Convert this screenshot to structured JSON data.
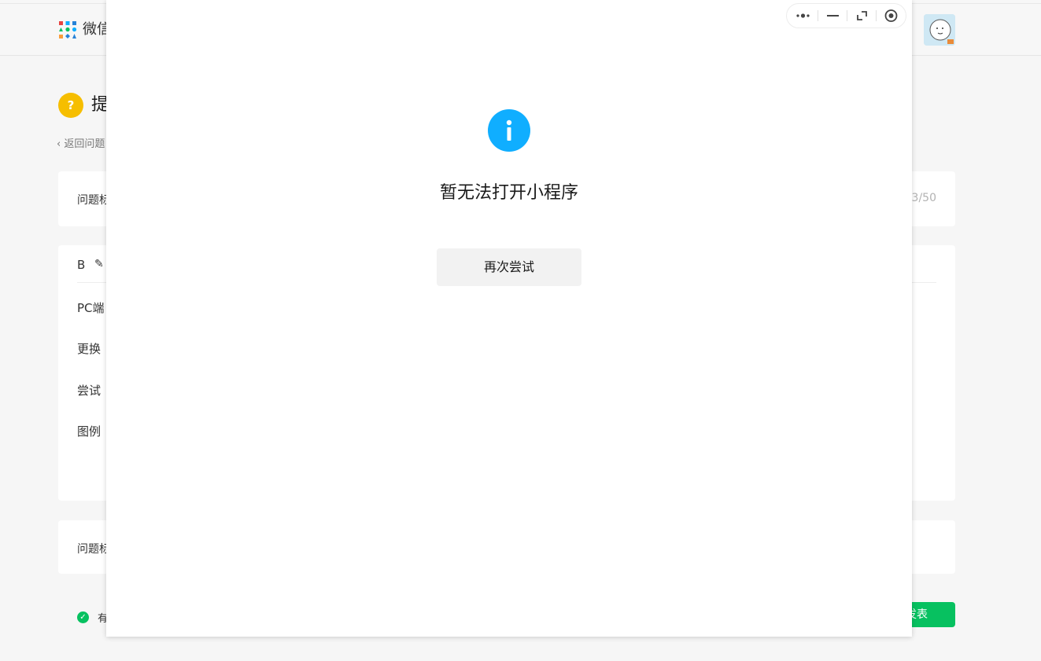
{
  "header": {
    "brand": "微信",
    "avatar_label": "avatar"
  },
  "page": {
    "title": "提",
    "back_link": "返回问题"
  },
  "title_card": {
    "label": "问题标",
    "char_count": "3/50"
  },
  "editor": {
    "bold_label": "B",
    "lines": [
      "PC端",
      "更换",
      "尝试",
      "图例"
    ]
  },
  "tags_card": {
    "label": "问题标"
  },
  "footer": {
    "agree_text": "有",
    "submit_label": "发表"
  },
  "modal": {
    "message": "暂无法打开小程序",
    "retry_label": "再次尝试"
  },
  "colors": {
    "info_blue": "#10aeff",
    "wechat_green": "#07c160",
    "warning_yellow": "#f6be00"
  },
  "icons": {
    "capsule": [
      "more-icon",
      "minimize-icon",
      "restore-icon",
      "close-icon"
    ],
    "status": "info-icon"
  }
}
